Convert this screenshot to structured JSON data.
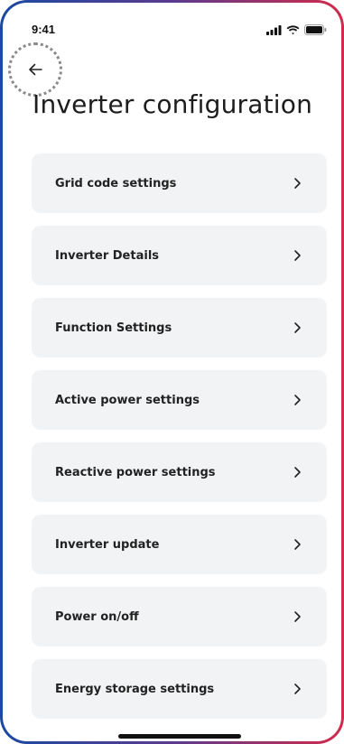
{
  "status_bar": {
    "time": "9:41",
    "icons": [
      "signal-icon",
      "wifi-icon",
      "battery-icon"
    ]
  },
  "header": {
    "back_icon": "arrow-left-icon",
    "title": "Inverter configuration"
  },
  "menu": {
    "chevron_icon": "chevron-right-icon",
    "items": [
      {
        "label": "Grid code settings"
      },
      {
        "label": "Inverter Details"
      },
      {
        "label": "Function Settings"
      },
      {
        "label": "Active power settings"
      },
      {
        "label": "Reactive power settings"
      },
      {
        "label": "Inverter update"
      },
      {
        "label": "Power on/off"
      },
      {
        "label": "Energy storage settings"
      }
    ]
  },
  "colors": {
    "frame_gradient_start": "#1a4aa3",
    "frame_gradient_end": "#d22a4b",
    "card_background": "#f1f3f5",
    "text_primary": "#222222"
  }
}
